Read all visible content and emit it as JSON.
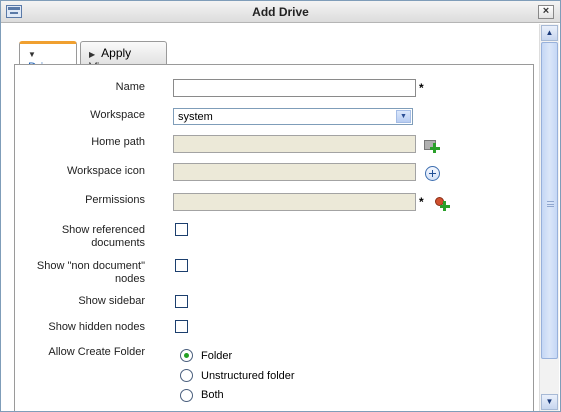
{
  "window": {
    "title": "Add Drive",
    "close_label": "×"
  },
  "tabs": [
    {
      "label": "Drive",
      "active": true
    },
    {
      "label": "Apply Views",
      "active": false
    }
  ],
  "form": {
    "name": {
      "label": "Name",
      "value": "",
      "required_mark": "*"
    },
    "workspace": {
      "label": "Workspace",
      "selected": "system"
    },
    "home_path": {
      "label": "Home path",
      "value": ""
    },
    "workspace_icon": {
      "label": "Workspace icon",
      "value": ""
    },
    "permissions": {
      "label": "Permissions",
      "value": "",
      "required_mark": "*"
    },
    "show_referenced": {
      "label_line1": "Show referenced",
      "label_line2": "documents",
      "checked": false
    },
    "show_non_document": {
      "label_line1": "Show \"non document\"",
      "label_line2": "nodes",
      "checked": false
    },
    "show_sidebar": {
      "label": "Show sidebar",
      "checked": false
    },
    "show_hidden": {
      "label": "Show hidden nodes",
      "checked": false
    },
    "allow_create_folder": {
      "label": "Allow Create Folder",
      "options": [
        {
          "label": "Folder",
          "checked": true
        },
        {
          "label": "Unstructured folder",
          "checked": false
        },
        {
          "label": "Both",
          "checked": false
        }
      ]
    }
  },
  "icons": {
    "window_icon": "window-icon",
    "home_path_action": "add-folder-icon",
    "workspace_icon_action": "add-circle-icon",
    "permissions_action": "add-permission-icon"
  }
}
